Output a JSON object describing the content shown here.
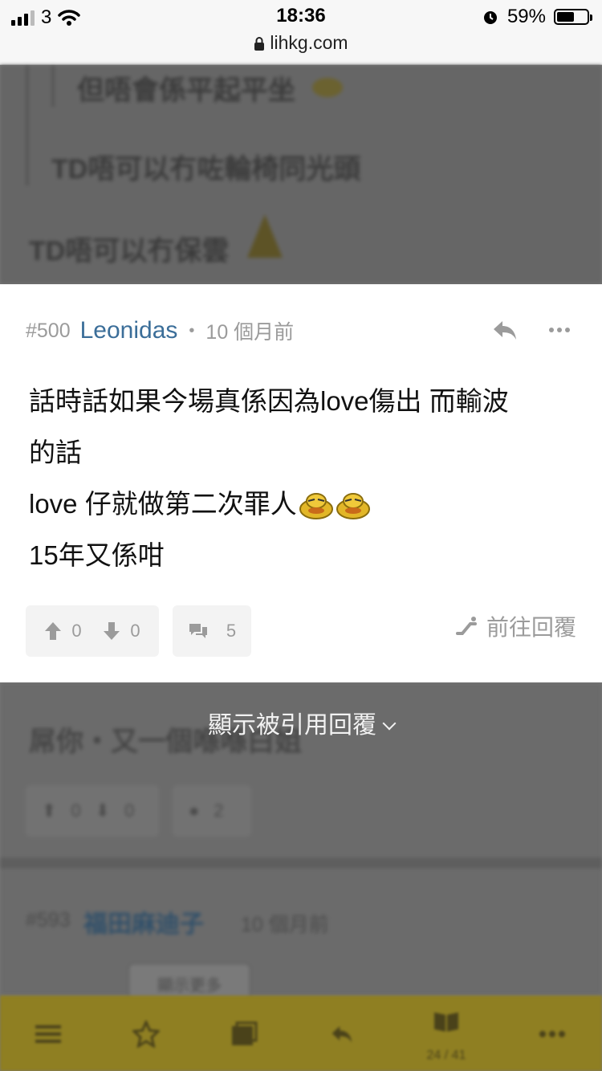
{
  "status_bar": {
    "carrier": "3",
    "time": "18:36",
    "url": "lihkg.com",
    "battery": "59%",
    "battery_level": 0.59
  },
  "background_posts": {
    "top": {
      "quote_line_1": "但唔會係平起平坐",
      "quote_line_2": "TD唔可以冇咗輪椅同光頭",
      "main_text": "TD唔可以冇保雲"
    },
    "bottom": {
      "text": "屌你・又一個喺喺白姐",
      "upvotes": "0",
      "downvotes": "0",
      "comments": "2",
      "next_floor": "#593",
      "next_user": "福田麻迪子",
      "next_time": "10 個月前",
      "next_button": "顯示更多"
    }
  },
  "post": {
    "floor": "#500",
    "username": "Leonidas",
    "time": "10 個月前",
    "lines": [
      "話時話如果今場真係因為love傷出 而輸波",
      "的話",
      "love 仔就做第二次罪人",
      "15年又係咁"
    ],
    "upvotes": "0",
    "downvotes": "0",
    "comments": "5",
    "goto_reply_label": "前往回覆"
  },
  "show_quoted_label": "顯示被引用回覆",
  "toolbar": {
    "page_indicator": "24 / 41",
    "items": [
      "menu-icon",
      "star-icon",
      "image-icon",
      "reply-icon",
      "book-icon",
      "more-icon"
    ]
  },
  "colors": {
    "username": "#3b6e99",
    "meta_gray": "#9b9b9b",
    "toolbar_bg": "#8f7f22",
    "overlay": "#777777"
  }
}
